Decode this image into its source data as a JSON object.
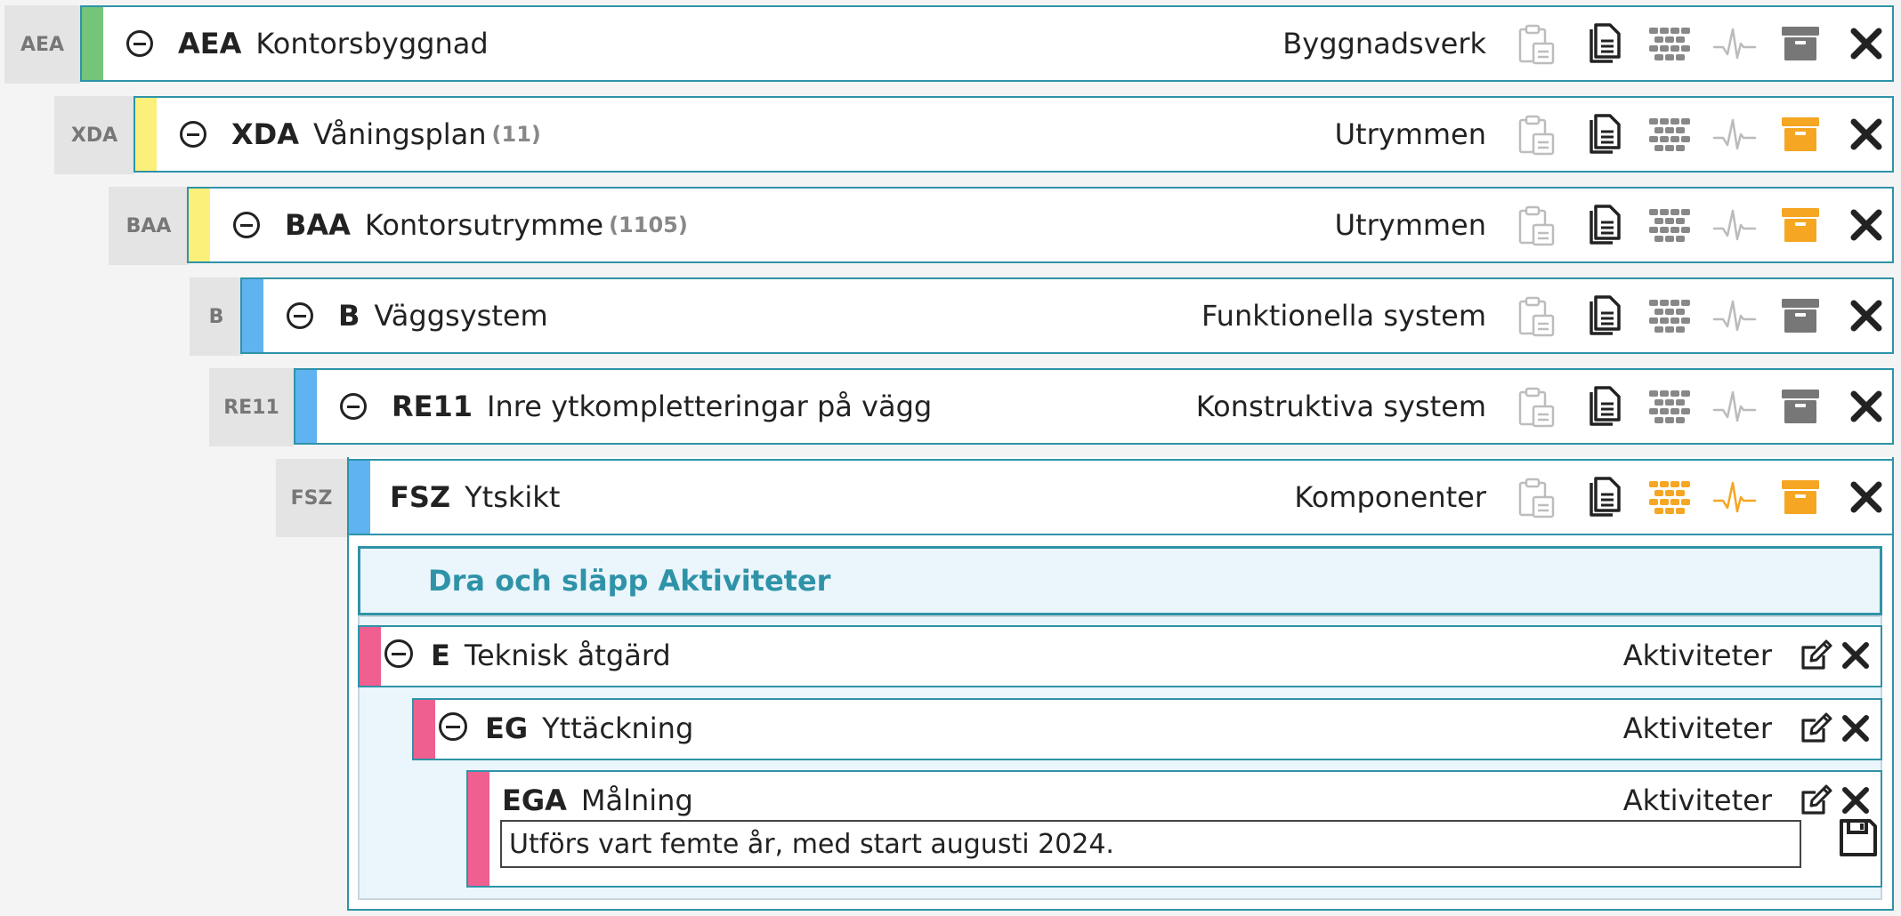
{
  "rows": [
    {
      "badge": "AEA",
      "code": "AEA",
      "name": "Kontorsbyggnad",
      "count": "",
      "category": "Byggnadsverk",
      "stripe": "#74c479",
      "collapsible": true,
      "layers_color": "#888",
      "pulse_color": "#bbb",
      "archive_color": "#777"
    },
    {
      "badge": "XDA",
      "code": "XDA",
      "name": "Våningsplan",
      "count": "(11)",
      "category": "Utrymmen",
      "stripe": "#fbf07a",
      "collapsible": true,
      "layers_color": "#888",
      "pulse_color": "#bbb",
      "archive_color": "#f5a623"
    },
    {
      "badge": "BAA",
      "code": "BAA",
      "name": "Kontorsutrymme",
      "count": "(1105)",
      "category": "Utrymmen",
      "stripe": "#fbf07a",
      "collapsible": true,
      "layers_color": "#888",
      "pulse_color": "#bbb",
      "archive_color": "#f5a623"
    },
    {
      "badge": "B",
      "code": "B",
      "name": "Väggsystem",
      "count": "",
      "category": "Funktionella system",
      "stripe": "#5fb3f0",
      "collapsible": true,
      "layers_color": "#888",
      "pulse_color": "#bbb",
      "archive_color": "#777"
    },
    {
      "badge": "RE11",
      "code": "RE11",
      "name": "Inre ytkompletteringar på vägg",
      "count": "",
      "category": "Konstruktiva system",
      "stripe": "#5fb3f0",
      "collapsible": true,
      "layers_color": "#888",
      "pulse_color": "#bbb",
      "archive_color": "#777"
    },
    {
      "badge": "FSZ",
      "code": "FSZ",
      "name": "Ytskikt",
      "count": "",
      "category": "Komponenter",
      "stripe": "#5fb3f0",
      "collapsible": false,
      "layers_color": "#f5a623",
      "pulse_color": "#f5a623",
      "archive_color": "#f5a623"
    }
  ],
  "activities": {
    "drop_label": "Dra och släpp Aktiviteter",
    "items": [
      {
        "code": "E",
        "name": "Teknisk åtgärd",
        "category": "Aktiviteter"
      },
      {
        "code": "EG",
        "name": "Yttäckning",
        "category": "Aktiviteter"
      },
      {
        "code": "EGA",
        "name": "Målning",
        "category": "Aktiviteter"
      }
    ],
    "note_value": "Utförs vart femte år, med start augusti 2024.",
    "accent": "#ef5f8f"
  },
  "icons": [
    "clipboard-icon",
    "documents-icon",
    "layers-icon",
    "pulse-icon",
    "archive-icon",
    "close-icon",
    "edit-icon",
    "save-icon"
  ]
}
